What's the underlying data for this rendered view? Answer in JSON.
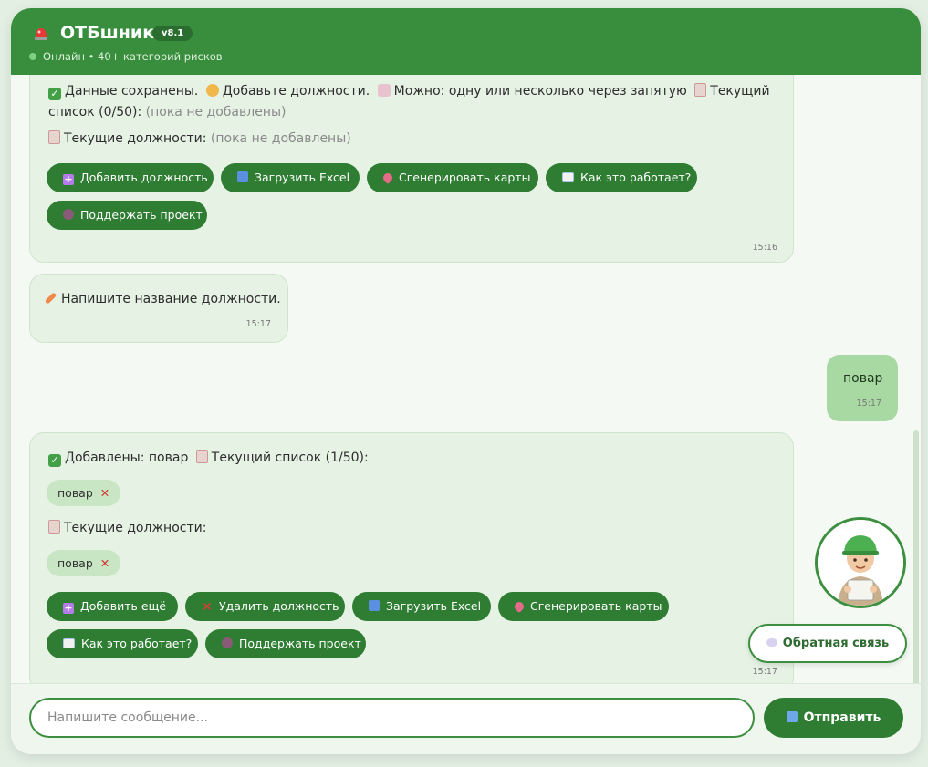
{
  "header": {
    "title": "ОТБшник",
    "version": "v8.1",
    "status": "Онлайн • 40+ категорий рисков"
  },
  "messages": {
    "m1": {
      "line1a": "Данные сохранены.",
      "line1b": "Добавьте должности.",
      "line1c": "Можно: одну или несколько через запятую",
      "line1d": "Текущий",
      "line2a": "список (0/50):",
      "line2b": "(пока не добавлены)",
      "line3a": "Текущие должности:",
      "line3b": "(пока не добавлены)",
      "buttons": [
        "Добавить должность",
        "Загрузить Excel",
        "Сгенерировать карты",
        "Как это работает?",
        "Поддержать проект"
      ],
      "time": "15:16"
    },
    "m2": {
      "text": "Напишите название должности.",
      "time": "15:17"
    },
    "user": {
      "text": "повар",
      "time": "15:17"
    },
    "m3": {
      "line1a": "Добавлены: повар",
      "line1b": "Текущий список (1/50):",
      "chip1": "повар",
      "line2": "Текущие должности:",
      "chip2": "повар",
      "buttons": [
        "Добавить ещё",
        "Удалить должность",
        "Загрузить Excel",
        "Сгенерировать карты",
        "Как это работает?",
        "Поддержать проект"
      ],
      "time": "15:17"
    }
  },
  "feedback": {
    "label": "Обратная связь"
  },
  "input": {
    "placeholder": "Напишите сообщение...",
    "send_label": "Отправить"
  },
  "colors": {
    "primary": "#388e3c",
    "button": "#2e7d32",
    "bubble": "#e6f3e4",
    "user_bubble": "#a8d9a2"
  }
}
